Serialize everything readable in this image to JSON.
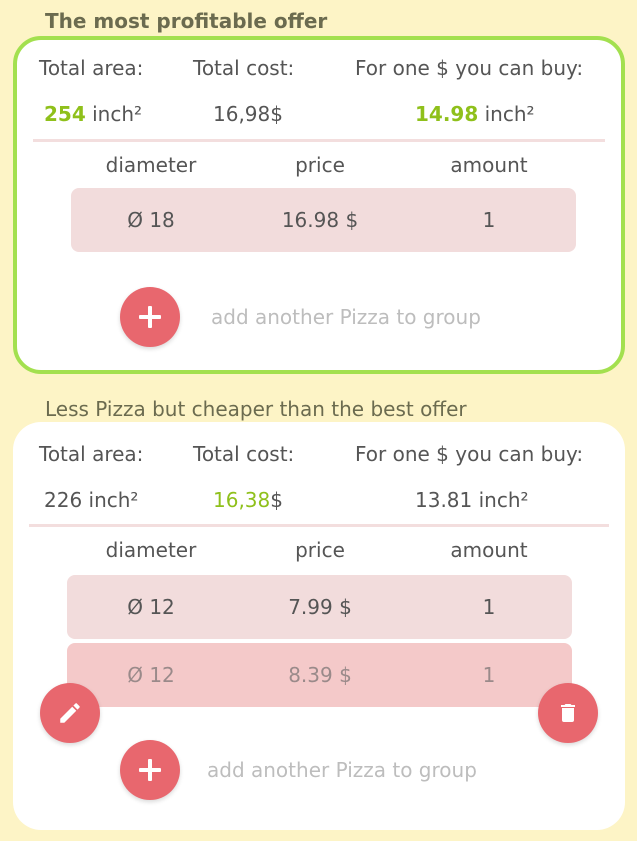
{
  "best": {
    "title": "The most profitable offer",
    "labels": {
      "area": "Total area:",
      "cost": "Total cost:",
      "per_dollar": "For one $ you can buy:"
    },
    "area_value": "254",
    "area_unit": " inch²",
    "cost_value": "16,98$",
    "per_dollar_value": "14.98",
    "per_dollar_unit": " inch²",
    "columns": [
      "diameter",
      "price",
      "amount"
    ],
    "rows": [
      {
        "diameter": "Ø 18",
        "price": "16.98 $",
        "amount": "1"
      }
    ],
    "add_label": "add another Pizza to group"
  },
  "cheap": {
    "title": "Less Pizza but cheaper than the best offer",
    "labels": {
      "area": "Total area:",
      "cost": "Total cost:",
      "per_dollar": "For one $ you can buy:"
    },
    "area_value": "226 inch²",
    "cost_value": "16,38",
    "cost_suffix": "$",
    "per_dollar_value": "13.81 inch²",
    "columns": [
      "diameter",
      "price",
      "amount"
    ],
    "rows": [
      {
        "diameter": "Ø 12",
        "price": "7.99 $",
        "amount": "1"
      },
      {
        "diameter": "Ø 12",
        "price": "8.39 $",
        "amount": "1"
      }
    ],
    "add_label": "add another Pizza to group"
  },
  "colors": {
    "accent_green": "#8fc01b",
    "fab_red": "#e8676e",
    "background": "#fdf4c6"
  }
}
